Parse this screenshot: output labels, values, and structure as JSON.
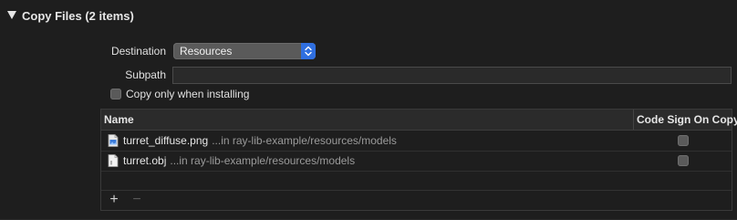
{
  "phase": {
    "title": "Copy Files (2 items)"
  },
  "destination": {
    "label": "Destination",
    "value": "Resources"
  },
  "subpath": {
    "label": "Subpath",
    "value": ""
  },
  "copy_only_installing": {
    "label": "Copy only when installing",
    "checked": false
  },
  "table": {
    "columns": {
      "name": "Name",
      "code_sign": "Code Sign On Copy"
    },
    "rows": [
      {
        "file": "turret_diffuse.png",
        "path": "...in ray-lib-example/resources/models",
        "icon": "image-file-icon",
        "code_sign": false
      },
      {
        "file": "turret.obj",
        "path": "...in ray-lib-example/resources/models",
        "icon": "document-file-icon",
        "code_sign": false
      }
    ]
  },
  "footer": {
    "add": "+",
    "remove": "−"
  },
  "colors": {
    "accent": "#2f6fe0",
    "background": "#1e1e1e"
  }
}
